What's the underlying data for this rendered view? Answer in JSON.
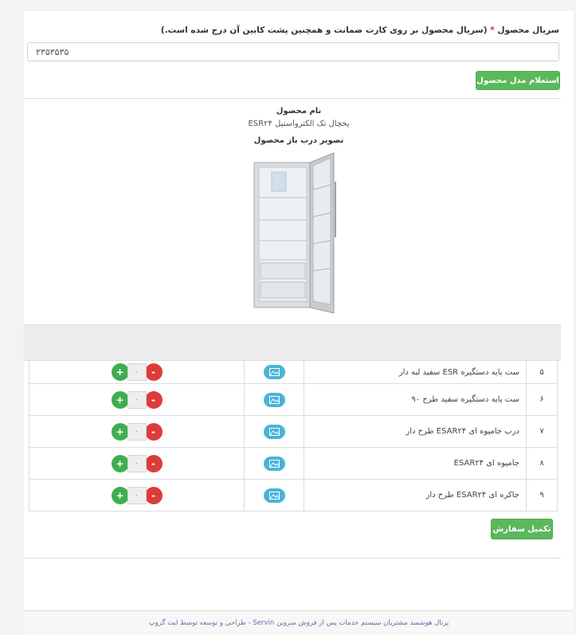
{
  "form": {
    "serial_label": "سریال محصول",
    "required_mark": "*",
    "serial_hint": "(سریال محصول بر روی کارت ضمانت و همچنین پشت کابین آن درج شده است.)",
    "serial_value": "۲۳۵۳۵۳۵",
    "inquiry_button": "استعلام مدل محصول"
  },
  "product": {
    "name_label": "نام محصول",
    "name": "یخچال تک الکترواستیل ESR۲۴",
    "image_label": "تصویر درب باز محصول"
  },
  "parts_table": {
    "rows": [
      {
        "num": "۵",
        "name": "ست پایه دستگیره ESR سفید لبه دار",
        "qty": "۰"
      },
      {
        "num": "۶",
        "name": "ست پایه دستگیره سفید طرح ۹۰",
        "qty": "۰"
      },
      {
        "num": "۷",
        "name": "درب جامیوه ای ESAR۲۴ طرح دار",
        "qty": "۰"
      },
      {
        "num": "۸",
        "name": "جامیوه ای ESAR۲۴",
        "qty": "۰"
      },
      {
        "num": "۹",
        "name": "جاکره ای ESAR۲۴ طرح دار",
        "qty": "۰"
      }
    ],
    "plus_symbol": "+",
    "minus_symbol": "-"
  },
  "actions": {
    "complete_order_button": "تکمیل سفارش"
  },
  "footer": {
    "text": "پرتال هوشمند مشتریان سیستم خدمات پس از فروش سروین Servin - طراحی و توسعه توسط ایت گروپ"
  },
  "icons": {
    "image_button": "image-icon",
    "increase": "plus-icon",
    "decrease": "minus-icon"
  },
  "colors": {
    "accent_green": "#5cb85c",
    "plus_green": "#3fae4f",
    "minus_red": "#dd3b3b",
    "image_blue": "#4ab3d9",
    "required_red": "#d9262c"
  }
}
